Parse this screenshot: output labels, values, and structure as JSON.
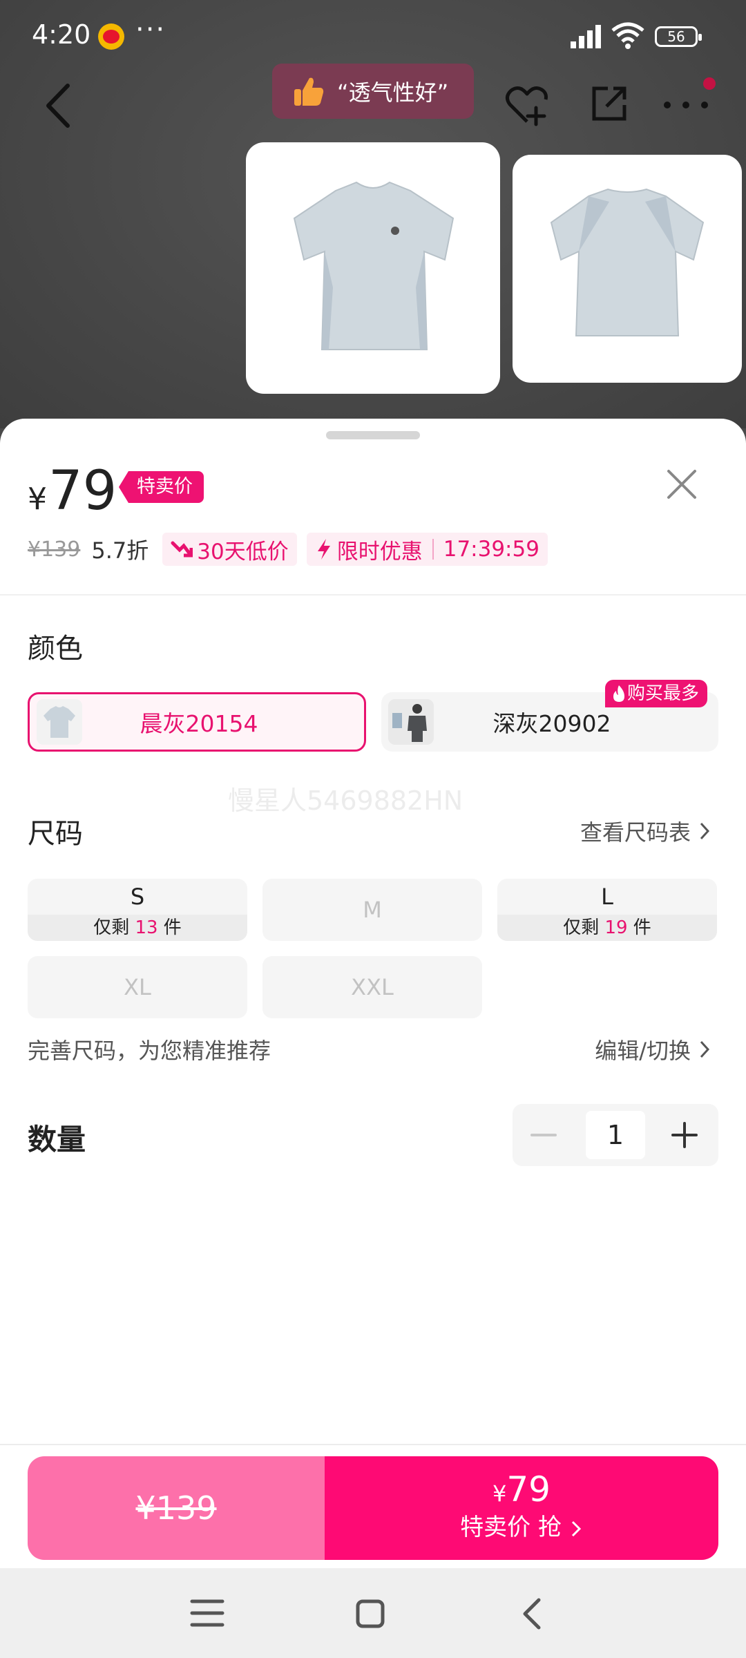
{
  "status_bar": {
    "time": "4:20",
    "more": "···",
    "battery": "56"
  },
  "header": {
    "review_tag": "“透气性好”"
  },
  "price": {
    "currency": "¥",
    "current": "79",
    "tag": "特卖价",
    "original": "¥139",
    "discount": "5.7折",
    "low_price_badge": "30天低价",
    "flash_label": "限时优惠",
    "countdown": "17:39:59"
  },
  "color_section": {
    "title": "颜色",
    "options": [
      {
        "label": "晨灰20154",
        "selected": true
      },
      {
        "label": "深灰20902",
        "selected": false
      }
    ],
    "hot_badge": "购买最多"
  },
  "watermark": "慢星人5469882HN",
  "size_section": {
    "title": "尺码",
    "chart_link": "查看尺码表",
    "sizes": [
      {
        "label": "S",
        "stock_prefix": "仅剩 ",
        "stock": "13",
        "stock_suffix": " 件"
      },
      {
        "label": "M"
      },
      {
        "label": "L",
        "stock_prefix": "仅剩 ",
        "stock": "19",
        "stock_suffix": " 件"
      },
      {
        "label": "XL"
      },
      {
        "label": "XXL"
      }
    ],
    "recommend_text": "完善尺码，为您精准推荐",
    "edit_link": "编辑/切换"
  },
  "quantity": {
    "title": "数量",
    "value": "1"
  },
  "bottom_bar": {
    "original_price": "¥139",
    "buy_currency": "¥",
    "buy_price": "79",
    "buy_label": "特卖价 抢"
  },
  "colors": {
    "accent": "#e8126f",
    "buy_button": "#fe0a74",
    "orig_button": "#fd70aa"
  }
}
